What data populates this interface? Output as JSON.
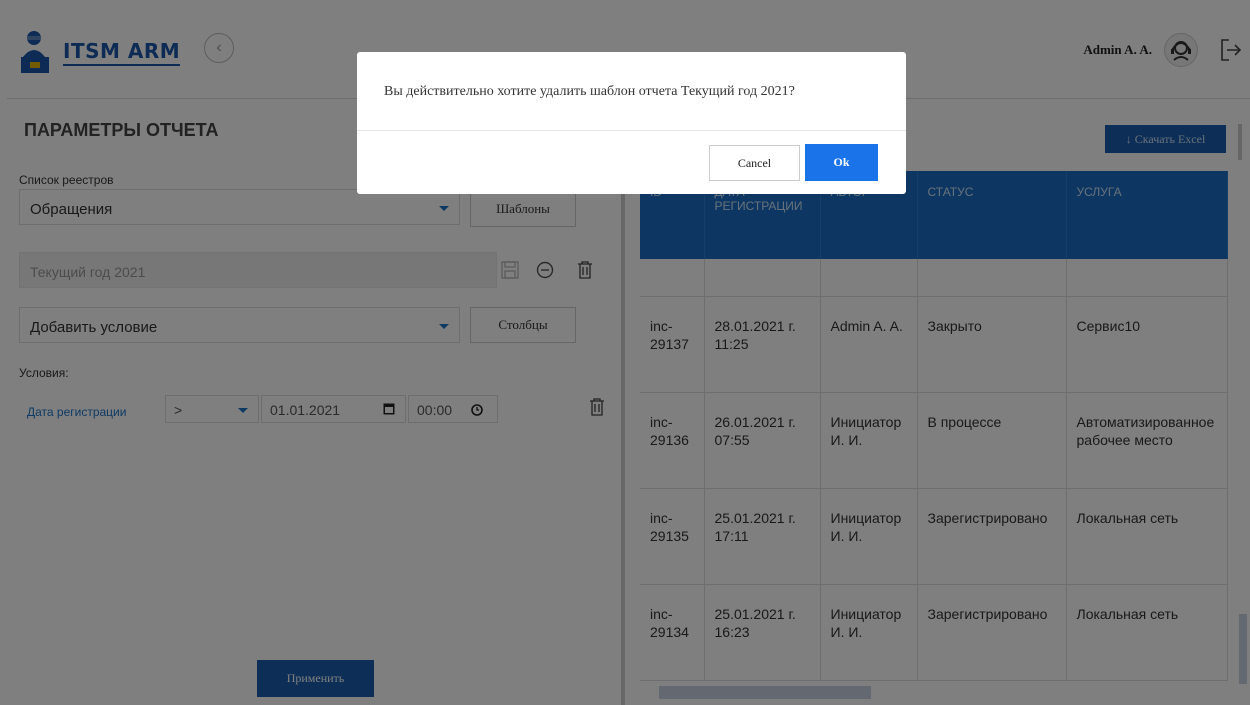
{
  "header": {
    "logo_text": "ITSM ARM",
    "user_name": "Admin A. A."
  },
  "left": {
    "title": "ПАРАМЕТРЫ ОТЧЕТА",
    "registry_label": "Список реестров",
    "registry_value": "Обращения",
    "templates_button": "Шаблоны",
    "template_value": "Текущий год 2021",
    "add_condition": "Добавить условие",
    "columns_button": "Столбцы",
    "conditions_label": "Условия:",
    "condition": {
      "field": "Дата регистрации",
      "operator": ">",
      "date": "01.01.2021",
      "time": "00:00"
    },
    "apply_button": "Применить"
  },
  "right": {
    "excel_button": "↓ Скачать Excel",
    "columns": [
      "ID",
      "ДАТА РЕГИСТРАЦИИ",
      "АВТОР",
      "СТАТУС",
      "УСЛУГА"
    ],
    "rows": [
      {
        "id": "inc-29137",
        "date": "28.01.2021 г. 11:25",
        "author": "Admin A. A.",
        "status": "Закрыто",
        "service": "Сервис10"
      },
      {
        "id": "inc-29136",
        "date": "26.01.2021 г. 07:55",
        "author": "Инициатор И. И.",
        "status": "В процессе",
        "service": "Автоматизированное рабочее место"
      },
      {
        "id": "inc-29135",
        "date": "25.01.2021 г. 17:11",
        "author": "Инициатор И. И.",
        "status": "Зарегистрировано",
        "service": "Локальная сеть"
      },
      {
        "id": "inc-29134",
        "date": "25.01.2021 г. 16:23",
        "author": "Инициатор И. И.",
        "status": "Зарегистрировано",
        "service": "Локальная сеть"
      }
    ]
  },
  "dialog": {
    "message": "Вы действительно хотите удалить шаблон отчета Текущий год 2021?",
    "cancel": "Cancel",
    "ok": "Ok"
  },
  "colors": {
    "brand": "#1a56a8",
    "primary_button": "#1a5fae",
    "table_header": "#1a6ec4",
    "ok_button": "#1a73e8"
  }
}
